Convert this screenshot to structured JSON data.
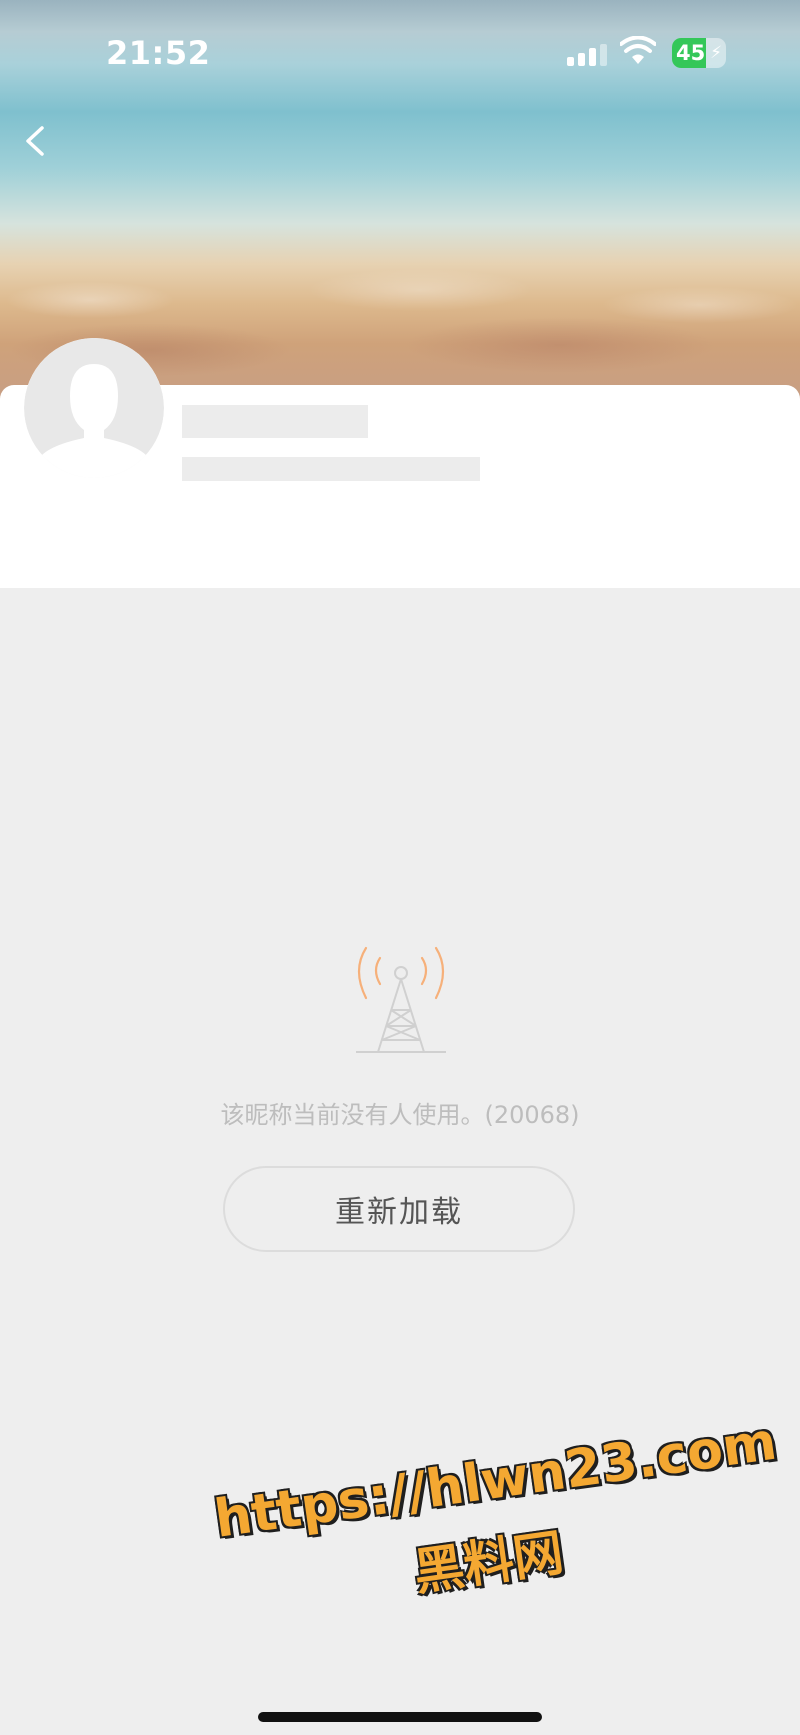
{
  "status_bar": {
    "time": "21:52",
    "battery_level": "45",
    "battery_color": "#34c759",
    "icons": [
      "signal-icon",
      "wifi-icon",
      "battery-icon",
      "charging-bolt-icon"
    ]
  },
  "header": {
    "back_icon": "chevron-left-icon"
  },
  "profile": {
    "avatar_icon": "default-avatar-icon",
    "loading": true
  },
  "error": {
    "icon": "signal-tower-icon",
    "message": "该昵称当前没有人使用。(20068)",
    "accent_color": "#f6a55a"
  },
  "actions": {
    "reload_label": "重新加载"
  },
  "watermark": {
    "url": "https://hlwn23.com",
    "site_name": "黑料网",
    "color": "#f4a832"
  }
}
